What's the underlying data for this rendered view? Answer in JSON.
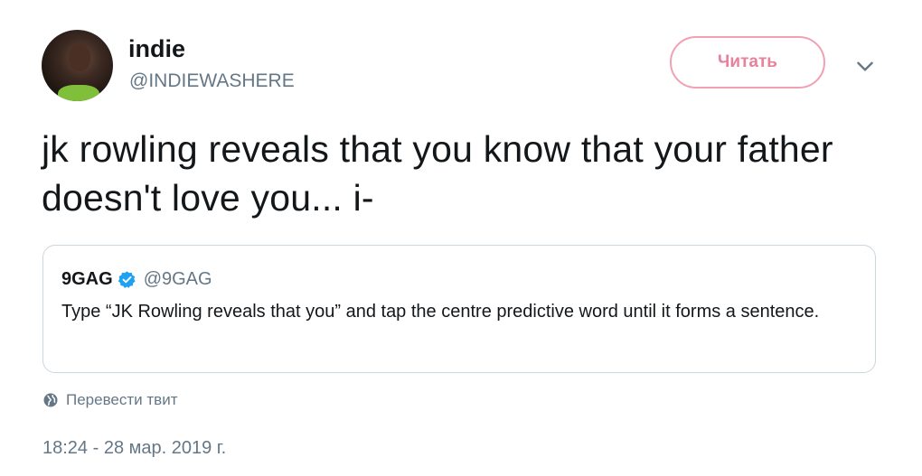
{
  "author": {
    "name": "indie",
    "handle": "@INDIEWASHERE"
  },
  "follow_button": {
    "label": "Читать"
  },
  "tweet": {
    "text": "jk rowling reveals that you know that your father doesn't love you... i-",
    "translate_label": "Перевести твит",
    "timestamp": "18:24 - 28 мар. 2019 г."
  },
  "quoted_tweet": {
    "name": "9GAG",
    "verified": true,
    "handle": "@9GAG",
    "text": "Type “JK Rowling reveals that you” and tap the centre predictive word until it forms a sentence."
  },
  "colors": {
    "follow_border": "#f2a0b4",
    "follow_text": "#e8819c",
    "verified_blue": "#1da1f2",
    "secondary_text": "#657786",
    "primary_text": "#14171a",
    "card_border": "#ccd6dd"
  },
  "icons": {
    "caret": "chevron-down-icon",
    "verified": "verified-badge-icon",
    "translate": "globe-icon"
  }
}
